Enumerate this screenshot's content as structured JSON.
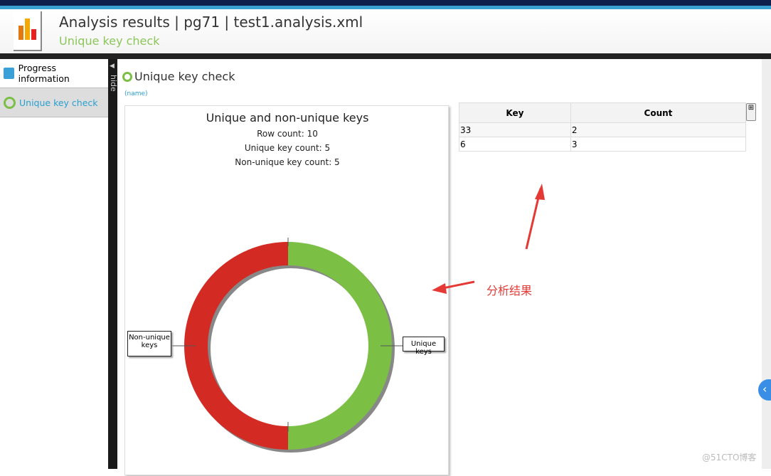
{
  "header": {
    "title": "Analysis results | pg71 | test1.analysis.xml",
    "subtitle": "Unique key check"
  },
  "sidebar": {
    "items": [
      {
        "label": "Progress information",
        "icon": "progress-icon"
      },
      {
        "label": "Unique key check",
        "icon": "donut-icon",
        "active": true
      }
    ],
    "hide_label": "hide"
  },
  "main": {
    "title": "Unique key check",
    "name": "(name)"
  },
  "chart_data": {
    "type": "pie",
    "title": "Unique and non-unique keys",
    "subtitle": [
      "Row count: 10",
      "Unique key count: 5",
      "Non-unique key count: 5"
    ],
    "categories": [
      "Unique keys",
      "Non-unique keys"
    ],
    "values": [
      5,
      5
    ],
    "colors": [
      "#7bbf45",
      "#d42a24"
    ],
    "donut": true
  },
  "table": {
    "columns": [
      "Key",
      "Count"
    ],
    "rows": [
      [
        "33",
        "2"
      ],
      [
        "6",
        "3"
      ]
    ]
  },
  "annotation": "分析结果",
  "watermark": "@51CTO博客"
}
